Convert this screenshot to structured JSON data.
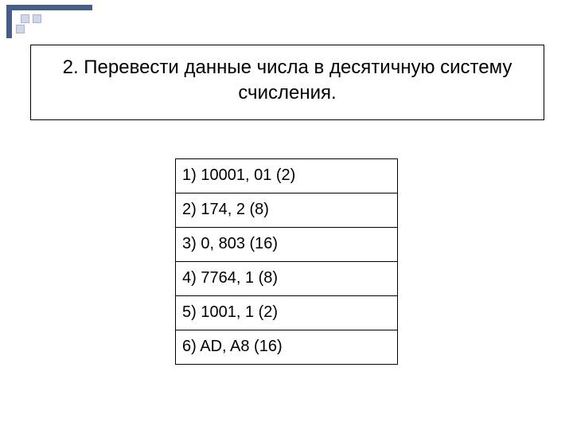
{
  "title": "2. Перевести данные числа в десятичную систему счисления.",
  "items": [
    "1) 10001, 01 (2)",
    "2) 174, 2 (8)",
    "3) 0, 803 (16)",
    "4) 7764, 1 (8)",
    "5) 1001, 1 (2)",
    "6) AD, A8 (16)"
  ]
}
